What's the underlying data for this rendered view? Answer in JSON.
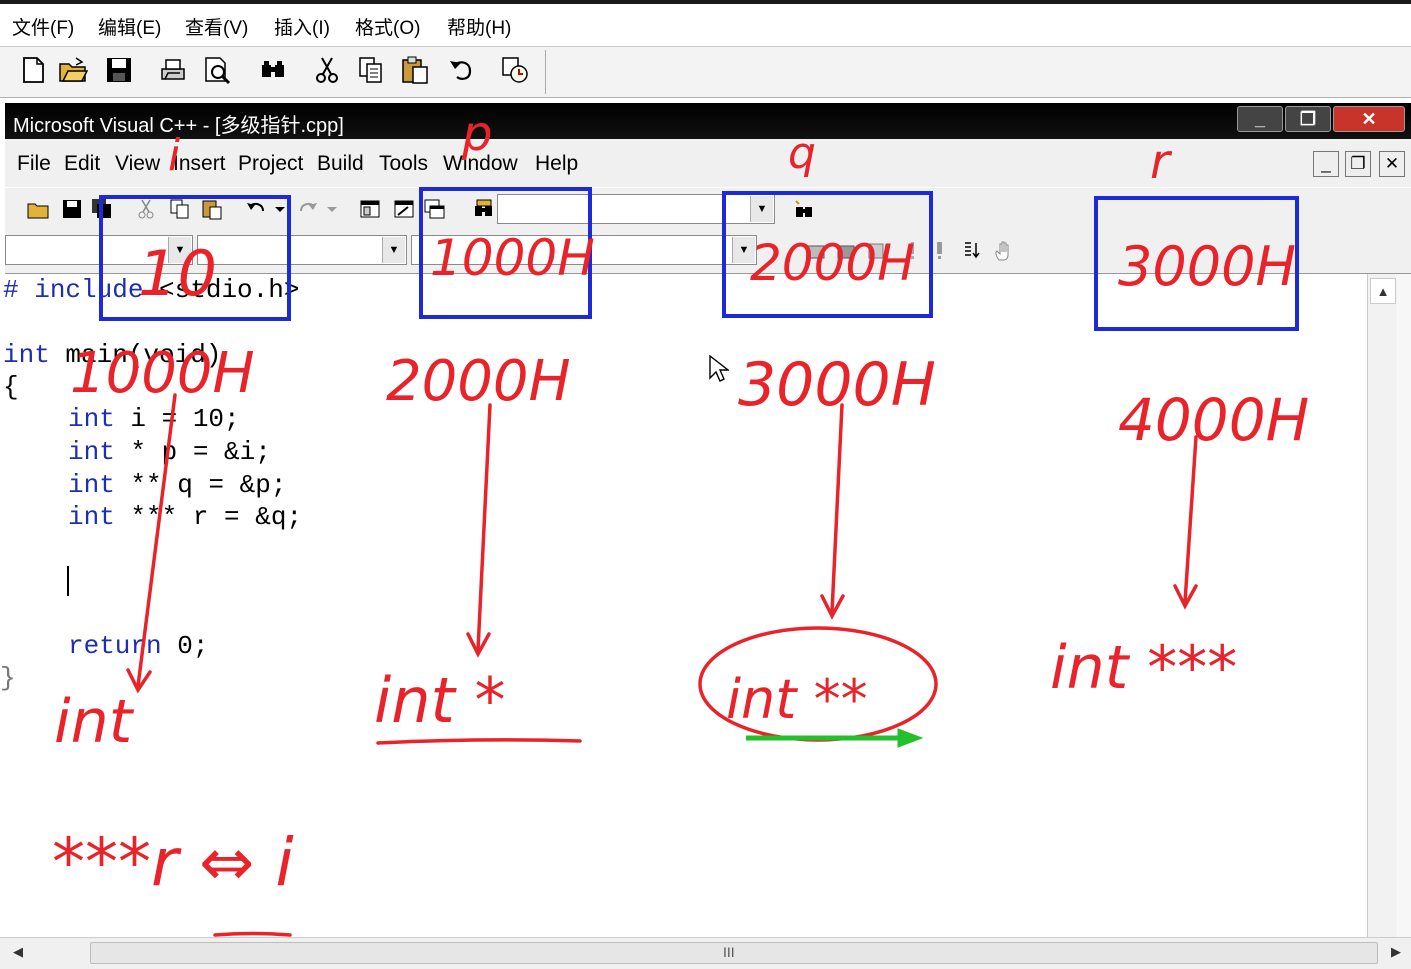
{
  "outer_menu": [
    "文件(F)",
    "编辑(E)",
    "查看(V)",
    "插入(I)",
    "格式(O)",
    "帮助(H)"
  ],
  "outer_toolbar_icons": [
    "new-document-icon",
    "open-folder-icon",
    "save-icon",
    "print-icon",
    "print-preview-icon",
    "find-icon",
    "cut-icon",
    "copy-icon",
    "paste-icon",
    "undo-icon",
    "insert-datetime-icon"
  ],
  "vc_title": "Microsoft Visual C++ - [多级指针.cpp]",
  "vc_menu": [
    "File",
    "Edit",
    "View",
    "Insert",
    "Project",
    "Build",
    "Tools",
    "Window",
    "Help"
  ],
  "window_buttons": {
    "minimize": "_",
    "restore": "❐",
    "close": "✕"
  },
  "mdi_buttons": {
    "minimize": "_",
    "restore": "❐",
    "close": "✕"
  },
  "code": {
    "include_hash": "#",
    "include_kw": "include",
    "include_rest": " <stdio.h>",
    "main_kw": "int",
    "main_rest": " main(void)",
    "open_brace": "{",
    "line_i_kw": "int",
    "line_i_rest": " i = 10;",
    "line_p_kw": "int",
    "line_p_rest": " * p = &i;",
    "line_q_kw": "int",
    "line_q_rest": " ** q = &p;",
    "line_r_kw": "int",
    "line_r_rest": " *** r = &q;",
    "return_kw": "return",
    "return_rest": " 0;",
    "close_brace": "}"
  },
  "annotations": {
    "var_names": [
      "i",
      "p",
      "q",
      "r"
    ],
    "box_values": [
      "10",
      "1000H",
      "2000H",
      "3000H"
    ],
    "addresses": [
      "1000H",
      "2000H",
      "3000H",
      "4000H"
    ],
    "types": [
      "int",
      "int *",
      "int **",
      "int ***"
    ],
    "equivalence": "***r ⇔ i",
    "colors": {
      "ink": "#e8232a",
      "box": "#1d2ad6",
      "highlight": "#22c02a"
    }
  },
  "scroll_thumb_glyph": "III"
}
